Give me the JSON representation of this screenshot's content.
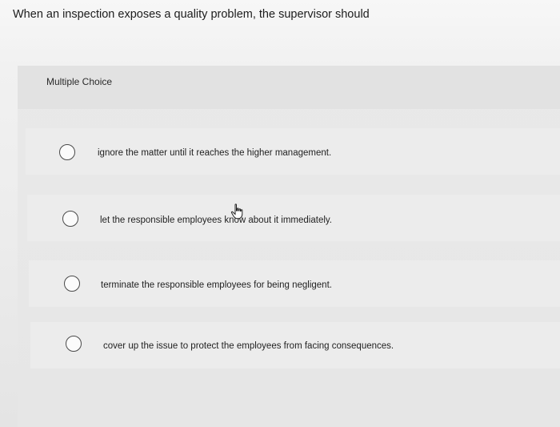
{
  "question": {
    "text": "When an inspection exposes a quality problem, the supervisor should"
  },
  "question_type": "Multiple Choice",
  "options": [
    {
      "label": "ignore the matter until it reaches the higher management."
    },
    {
      "label": "let the responsible employees know about it immediately."
    },
    {
      "label": "terminate the responsible employees for being negligent."
    },
    {
      "label": "cover up the issue to protect the employees from facing consequences."
    }
  ],
  "cursor_icon": "hand-pointer-icon"
}
